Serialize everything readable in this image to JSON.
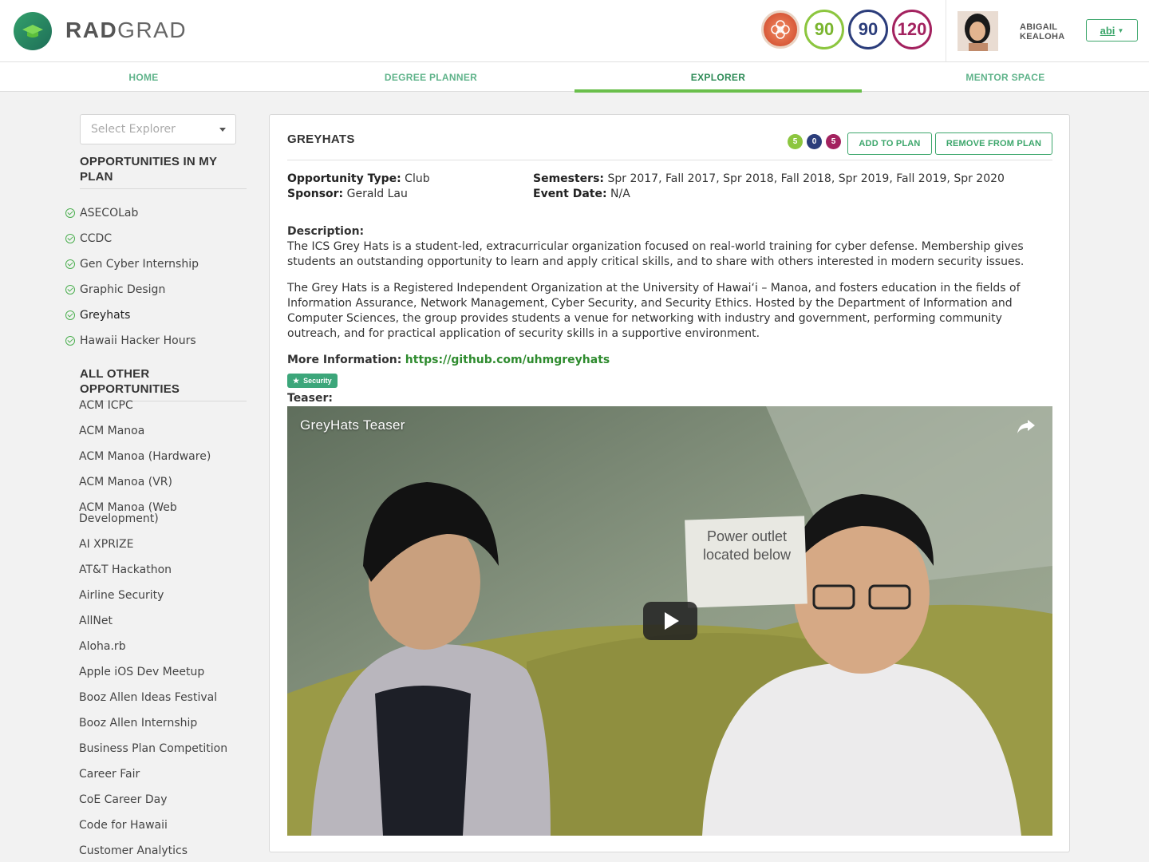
{
  "brand": {
    "bold": "RAD",
    "light": "GRAD"
  },
  "scores": {
    "green": "90",
    "blue": "90",
    "purple": "120"
  },
  "user": {
    "name_line1": "ABIGAIL",
    "name_line2": "KEALOHA",
    "menu_label": "abi"
  },
  "nav": {
    "home": "HOME",
    "degree_planner": "DEGREE PLANNER",
    "explorer": "EXPLORER",
    "mentor_space": "MENTOR SPACE"
  },
  "sidebar": {
    "select_placeholder": "Select Explorer",
    "plan_heading_line1": "OPPORTUNITIES IN MY",
    "plan_heading_line2": "PLAN",
    "plan_items": [
      "ASECOLab",
      "CCDC",
      "Gen Cyber Internship",
      "Graphic Design",
      "Greyhats",
      "Hawaii Hacker Hours"
    ],
    "other_heading": "ALL OTHER OPPORTUNITIES",
    "other_items": [
      "ACM ICPC",
      "ACM Manoa",
      "ACM Manoa (Hardware)",
      "ACM Manoa (VR)",
      "ACM Manoa (Web Development)",
      "AI XPRIZE",
      "AT&T Hackathon",
      "Airline Security",
      "AllNet",
      "Aloha.rb",
      "Apple iOS Dev Meetup",
      "Booz Allen Ideas Festival",
      "Booz Allen Internship",
      "Business Plan Competition",
      "Career Fair",
      "CoE Career Day",
      "Code for Hawaii",
      "Customer Analytics"
    ]
  },
  "panel": {
    "title": "GREYHATS",
    "mini_badges": {
      "green": "5",
      "blue": "0",
      "purple": "5"
    },
    "add_button": "ADD TO PLAN",
    "remove_button": "REMOVE FROM PLAN",
    "type_label": "Opportunity Type:",
    "type_value": "Club",
    "sponsor_label": "Sponsor:",
    "sponsor_value": "Gerald Lau",
    "semesters_label": "Semesters:",
    "semesters_value": "Spr 2017, Fall 2017, Spr 2018, Fall 2018, Spr 2019, Fall 2019, Spr 2020",
    "event_label": "Event Date:",
    "event_value": "N/A",
    "description_label": "Description:",
    "description_p1": "The ICS Grey Hats is a student-led, extracurricular organization focused on real-world training for cyber defense. Membership gives students an outstanding opportunity to learn and apply critical skills, and to share with others interested in modern security issues.",
    "description_p2": "The Grey Hats is a Registered Independent Organization at the University of Hawai‘i – Manoa, and fosters education in the fields of Information Assurance, Network Management, Cyber Security, and Security Ethics. Hosted by the Department of Information and Computer Sciences, the group provides students a venue for networking with industry and government, performing community outreach, and for practical application of security skills in a supportive environment.",
    "more_info_label": "More Information:",
    "more_info_link": "https://github.com/uhmgreyhats",
    "tag": "Security",
    "teaser_label": "Teaser:",
    "video_title": "GreyHats Teaser",
    "video_sign_line1": "Power outlet",
    "video_sign_line2": "located below"
  }
}
